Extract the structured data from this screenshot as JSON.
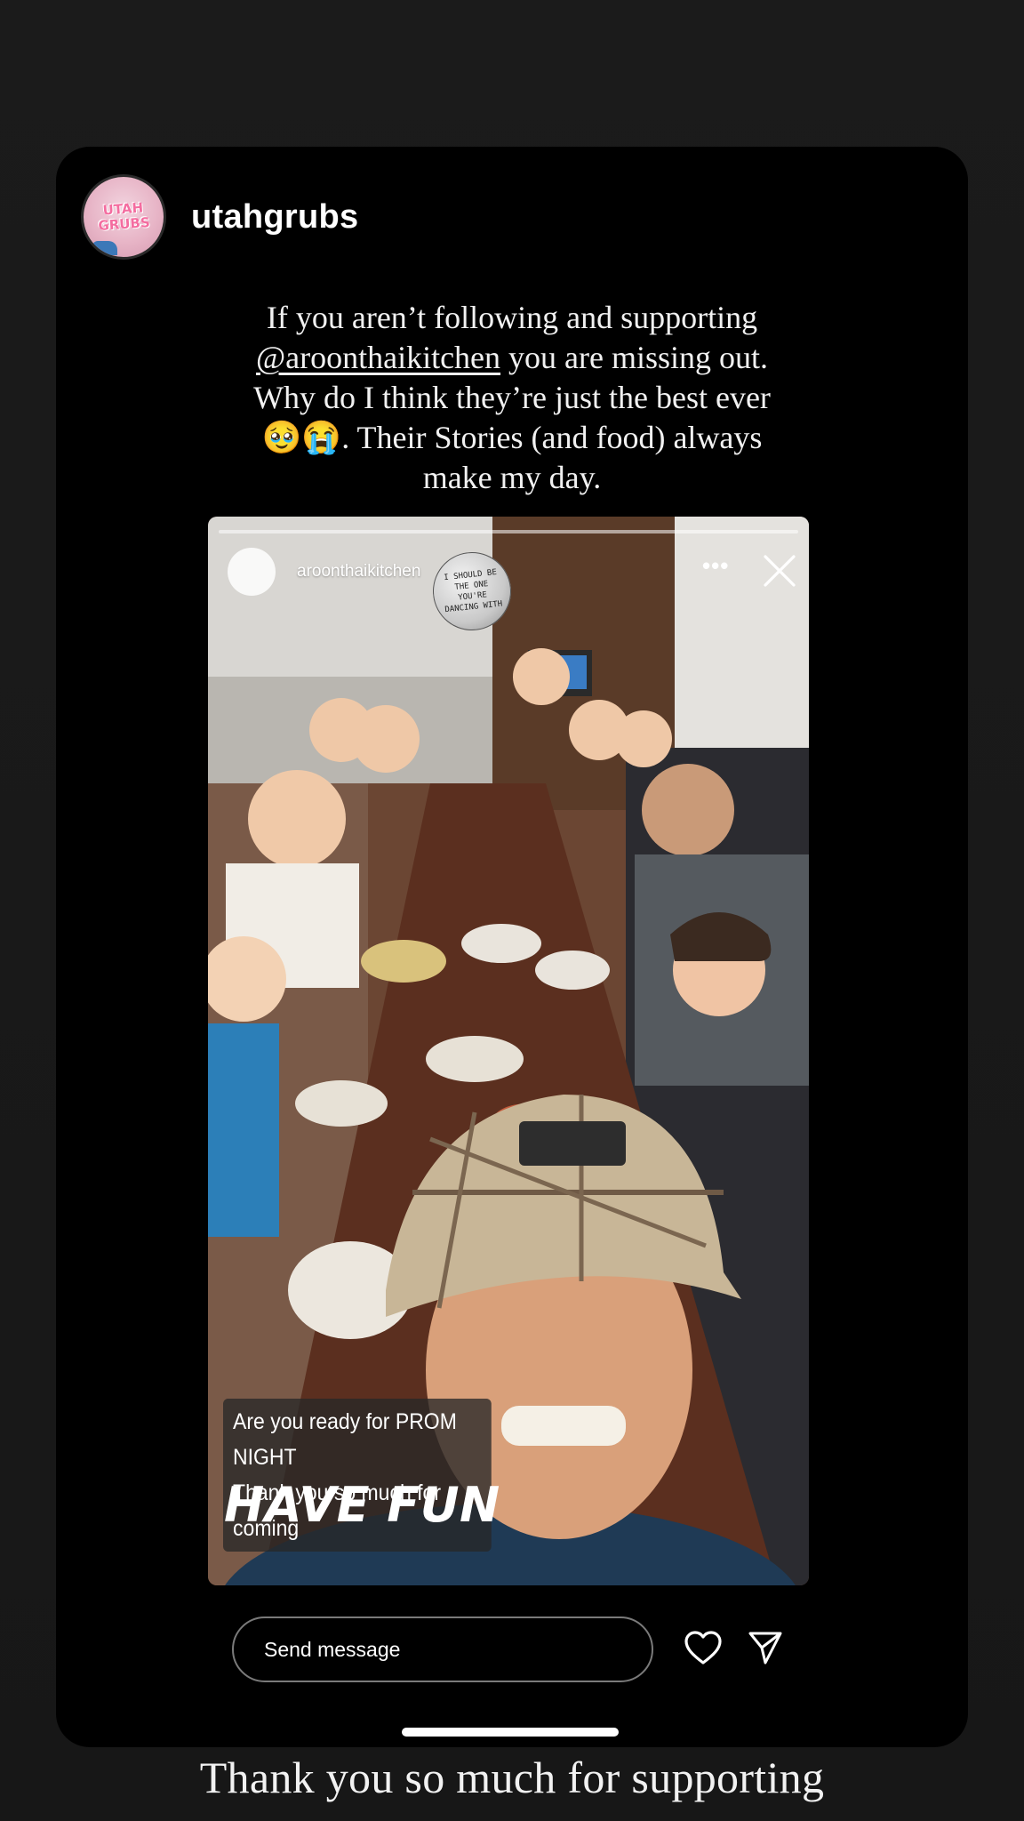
{
  "post": {
    "username": "utahgrubs",
    "avatar_text": "UTAH GRUBS",
    "caption_lines": [
      "If you aren’t following and supporting",
      "you are missing out.",
      "Why do I think they’re just the best ever",
      ". Their Stories (and food) always",
      "make my day."
    ],
    "mention": "@aroonthaikitchen",
    "emojis": "🥹😭"
  },
  "shared_story": {
    "username": "aroonthaikitchen",
    "more_label": "•••",
    "sticker_text": "I SHOULD BE THE ONE YOU'RE DANCING WITH",
    "overlay_line1": "Are you ready for PROM NIGHT",
    "overlay_line2": "Thank you so much for coming",
    "overlay_big": "HAVE FUN"
  },
  "reply": {
    "placeholder": "Send message"
  },
  "next_caption": "Thank you so much for supporting",
  "colors": {
    "background": "#1c1c1c",
    "card": "#000000",
    "text": "#ffffff"
  },
  "icons": [
    "close-icon",
    "more-icon",
    "heart-icon",
    "send-icon"
  ]
}
